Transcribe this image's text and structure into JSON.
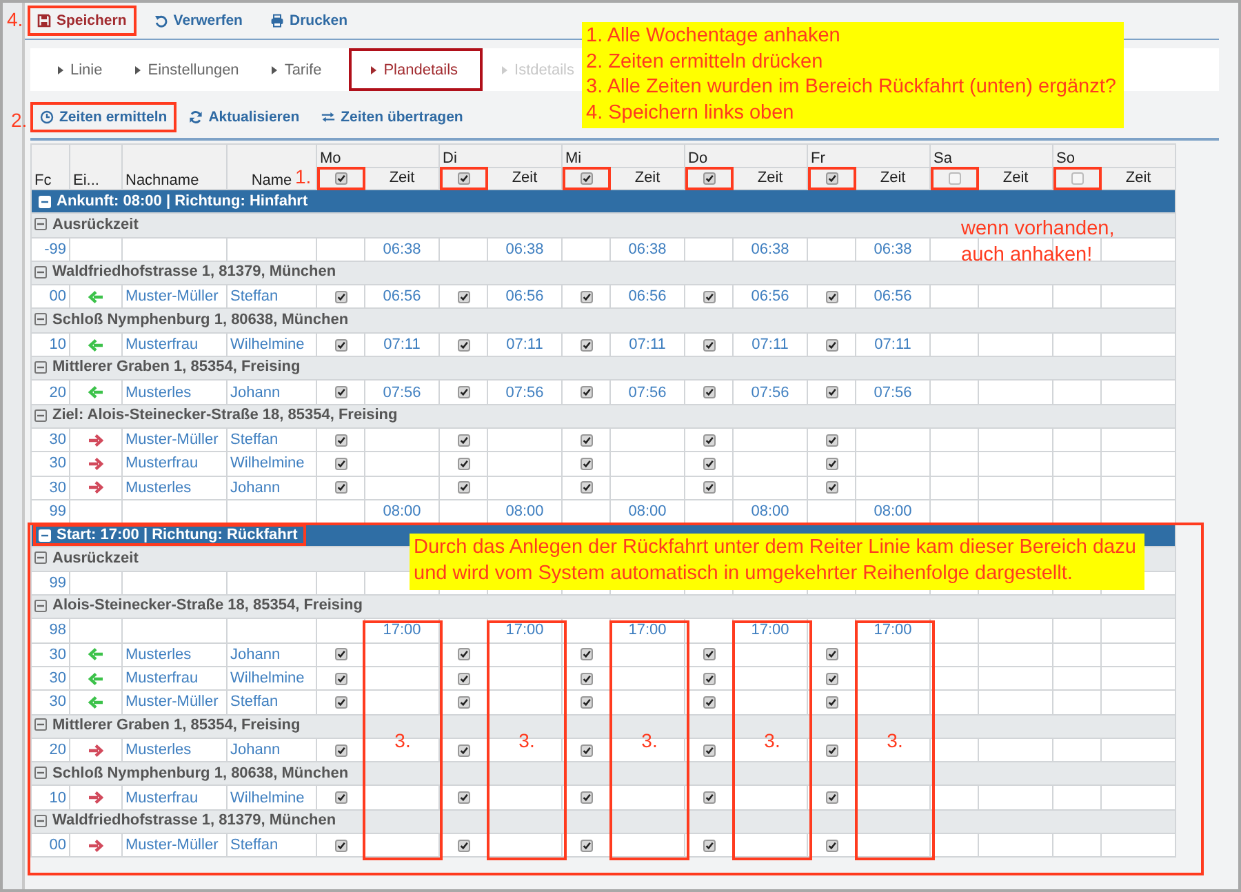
{
  "toolbar": {
    "step_label": "4.",
    "buttons": [
      {
        "label": "Speichern",
        "highlighted": true
      },
      {
        "label": "Verwerfen",
        "highlighted": false
      },
      {
        "label": "Drucken",
        "highlighted": false
      }
    ]
  },
  "tabs": [
    {
      "label": "Linie",
      "selected": false,
      "disabled": false,
      "highlighted": false
    },
    {
      "label": "Einstellungen",
      "selected": false,
      "disabled": false,
      "highlighted": false
    },
    {
      "label": "Tarife",
      "selected": false,
      "disabled": false,
      "highlighted": false
    },
    {
      "label": "Plandetails",
      "selected": true,
      "disabled": false,
      "highlighted": true
    },
    {
      "label": "Istdetails",
      "selected": false,
      "disabled": true,
      "highlighted": false
    }
  ],
  "actions": {
    "step_label": "2.",
    "buttons": [
      {
        "label": "Zeiten ermitteln",
        "highlighted": true
      },
      {
        "label": "Aktualisieren",
        "highlighted": false
      },
      {
        "label": "Zeiten übertragen",
        "highlighted": false
      }
    ]
  },
  "table": {
    "step_label": "1.",
    "columns": [
      "Fc",
      "Ei...",
      "Nachname",
      "Name"
    ],
    "days": [
      {
        "label": "Mo",
        "checked": true,
        "highlighted": true,
        "time_label": "Zeit"
      },
      {
        "label": "Di",
        "checked": true,
        "highlighted": true,
        "time_label": "Zeit"
      },
      {
        "label": "Mi",
        "checked": true,
        "highlighted": true,
        "time_label": "Zeit"
      },
      {
        "label": "Do",
        "checked": true,
        "highlighted": true,
        "time_label": "Zeit"
      },
      {
        "label": "Fr",
        "checked": true,
        "highlighted": true,
        "time_label": "Zeit"
      },
      {
        "label": "Sa",
        "checked": false,
        "highlighted": true,
        "time_label": "Zeit"
      },
      {
        "label": "So",
        "checked": false,
        "highlighted": true,
        "time_label": "Zeit"
      }
    ],
    "sections": [
      {
        "title": "Ankunft: 08:00 | Richtung: Hinfahrt",
        "expanded": true,
        "highlighted": false,
        "groups": [
          {
            "title": "Ausrückzeit",
            "expanded": true,
            "rows": [
              {
                "fc": "-99",
                "days": [
                  {
                    "checked": false,
                    "time": "06:38"
                  },
                  {
                    "checked": false,
                    "time": "06:38"
                  },
                  {
                    "checked": false,
                    "time": "06:38"
                  },
                  {
                    "checked": false,
                    "time": "06:38"
                  },
                  {
                    "checked": false,
                    "time": "06:38"
                  },
                  {
                    "checked": false
                  },
                  {
                    "checked": false
                  }
                ]
              }
            ]
          },
          {
            "title": "Waldfriedhofstrasse 1, 81379, München",
            "expanded": true,
            "rows": [
              {
                "fc": "00",
                "kind": "incoming",
                "nachname": "Muster-Müller",
                "name": "Steffan",
                "days": [
                  {
                    "checked": true,
                    "time": "06:56"
                  },
                  {
                    "checked": true,
                    "time": "06:56"
                  },
                  {
                    "checked": true,
                    "time": "06:56"
                  },
                  {
                    "checked": true,
                    "time": "06:56"
                  },
                  {
                    "checked": true,
                    "time": "06:56"
                  },
                  {
                    "checked": false
                  },
                  {
                    "checked": false
                  }
                ]
              }
            ]
          },
          {
            "title": "Schloß Nymphenburg 1, 80638, München",
            "expanded": true,
            "rows": [
              {
                "fc": "10",
                "kind": "incoming",
                "nachname": "Musterfrau",
                "name": "Wilhelmine",
                "days": [
                  {
                    "checked": true,
                    "time": "07:11"
                  },
                  {
                    "checked": true,
                    "time": "07:11"
                  },
                  {
                    "checked": true,
                    "time": "07:11"
                  },
                  {
                    "checked": true,
                    "time": "07:11"
                  },
                  {
                    "checked": true,
                    "time": "07:11"
                  },
                  {
                    "checked": false
                  },
                  {
                    "checked": false
                  }
                ]
              }
            ]
          },
          {
            "title": "Mittlerer Graben 1, 85354, Freising",
            "expanded": true,
            "rows": [
              {
                "fc": "20",
                "kind": "incoming",
                "nachname": "Musterles",
                "name": "Johann",
                "days": [
                  {
                    "checked": true,
                    "time": "07:56"
                  },
                  {
                    "checked": true,
                    "time": "07:56"
                  },
                  {
                    "checked": true,
                    "time": "07:56"
                  },
                  {
                    "checked": true,
                    "time": "07:56"
                  },
                  {
                    "checked": true,
                    "time": "07:56"
                  },
                  {
                    "checked": false
                  },
                  {
                    "checked": false
                  }
                ]
              }
            ]
          },
          {
            "title": "Ziel: Alois-Steinecker-Straße 18, 85354, Freising",
            "expanded": true,
            "rows": [
              {
                "fc": "30",
                "kind": "outgoing",
                "nachname": "Muster-Müller",
                "name": "Steffan",
                "days": [
                  {
                    "checked": true
                  },
                  {
                    "checked": true
                  },
                  {
                    "checked": true
                  },
                  {
                    "checked": true
                  },
                  {
                    "checked": true
                  },
                  {
                    "checked": false
                  },
                  {
                    "checked": false
                  }
                ]
              },
              {
                "fc": "30",
                "kind": "outgoing",
                "nachname": "Musterfrau",
                "name": "Wilhelmine",
                "days": [
                  {
                    "checked": true
                  },
                  {
                    "checked": true
                  },
                  {
                    "checked": true
                  },
                  {
                    "checked": true
                  },
                  {
                    "checked": true
                  },
                  {
                    "checked": false
                  },
                  {
                    "checked": false
                  }
                ]
              },
              {
                "fc": "30",
                "kind": "outgoing",
                "nachname": "Musterles",
                "name": "Johann",
                "days": [
                  {
                    "checked": true
                  },
                  {
                    "checked": true
                  },
                  {
                    "checked": true
                  },
                  {
                    "checked": true
                  },
                  {
                    "checked": true
                  },
                  {
                    "checked": false
                  },
                  {
                    "checked": false
                  }
                ]
              },
              {
                "fc": "99",
                "days": [
                  {
                    "checked": false,
                    "time": "08:00"
                  },
                  {
                    "checked": false,
                    "time": "08:00"
                  },
                  {
                    "checked": false,
                    "time": "08:00"
                  },
                  {
                    "checked": false,
                    "time": "08:00"
                  },
                  {
                    "checked": false,
                    "time": "08:00"
                  },
                  {
                    "checked": false
                  },
                  {
                    "checked": false
                  }
                ]
              }
            ]
          }
        ]
      },
      {
        "title": "Start: 17:00 | Richtung: Rückfahrt",
        "expanded": true,
        "highlighted": true,
        "groups": [
          {
            "title": "Ausrückzeit",
            "expanded": true,
            "rows": [
              {
                "fc": "99",
                "days": [
                  {
                    "checked": false
                  },
                  {
                    "checked": false
                  },
                  {
                    "checked": false
                  },
                  {
                    "checked": false
                  },
                  {
                    "checked": false
                  },
                  {
                    "checked": false
                  },
                  {
                    "checked": false
                  }
                ]
              }
            ]
          },
          {
            "title": "Alois-Steinecker-Straße 18, 85354, Freising",
            "expanded": true,
            "rows": [
              {
                "fc": "98",
                "days": [
                  {
                    "checked": false,
                    "time": "17:00"
                  },
                  {
                    "checked": false,
                    "time": "17:00"
                  },
                  {
                    "checked": false,
                    "time": "17:00"
                  },
                  {
                    "checked": false,
                    "time": "17:00"
                  },
                  {
                    "checked": false,
                    "time": "17:00"
                  },
                  {
                    "checked": false
                  },
                  {
                    "checked": false
                  }
                ]
              },
              {
                "fc": "30",
                "kind": "incoming",
                "nachname": "Musterles",
                "name": "Johann",
                "days": [
                  {
                    "checked": true
                  },
                  {
                    "checked": true
                  },
                  {
                    "checked": true
                  },
                  {
                    "checked": true
                  },
                  {
                    "checked": true
                  },
                  {
                    "checked": false
                  },
                  {
                    "checked": false
                  }
                ]
              },
              {
                "fc": "30",
                "kind": "incoming",
                "nachname": "Musterfrau",
                "name": "Wilhelmine",
                "days": [
                  {
                    "checked": true
                  },
                  {
                    "checked": true
                  },
                  {
                    "checked": true
                  },
                  {
                    "checked": true
                  },
                  {
                    "checked": true
                  },
                  {
                    "checked": false
                  },
                  {
                    "checked": false
                  }
                ]
              },
              {
                "fc": "30",
                "kind": "incoming",
                "nachname": "Muster-Müller",
                "name": "Steffan",
                "days": [
                  {
                    "checked": true
                  },
                  {
                    "checked": true
                  },
                  {
                    "checked": true
                  },
                  {
                    "checked": true
                  },
                  {
                    "checked": true
                  },
                  {
                    "checked": false
                  },
                  {
                    "checked": false
                  }
                ]
              }
            ]
          },
          {
            "title": "Mittlerer Graben 1, 85354, Freising",
            "expanded": true,
            "rows": [
              {
                "fc": "20",
                "kind": "outgoing",
                "nachname": "Musterles",
                "name": "Johann",
                "days": [
                  {
                    "checked": true
                  },
                  {
                    "checked": true
                  },
                  {
                    "checked": true
                  },
                  {
                    "checked": true
                  },
                  {
                    "checked": true
                  },
                  {
                    "checked": false
                  },
                  {
                    "checked": false
                  }
                ]
              }
            ]
          },
          {
            "title": "Schloß Nymphenburg 1, 80638, München",
            "expanded": true,
            "rows": [
              {
                "fc": "10",
                "kind": "outgoing",
                "nachname": "Musterfrau",
                "name": "Wilhelmine",
                "days": [
                  {
                    "checked": true
                  },
                  {
                    "checked": true
                  },
                  {
                    "checked": true
                  },
                  {
                    "checked": true
                  },
                  {
                    "checked": true
                  },
                  {
                    "checked": false
                  },
                  {
                    "checked": false
                  }
                ]
              }
            ]
          },
          {
            "title": "Waldfriedhofstrasse 1, 81379, München",
            "expanded": true,
            "rows": [
              {
                "fc": "00",
                "kind": "outgoing",
                "nachname": "Muster-Müller",
                "name": "Steffan",
                "days": [
                  {
                    "checked": true
                  },
                  {
                    "checked": true
                  },
                  {
                    "checked": true
                  },
                  {
                    "checked": true
                  },
                  {
                    "checked": true
                  },
                  {
                    "checked": false
                  },
                  {
                    "checked": false
                  }
                ]
              }
            ]
          }
        ]
      }
    ]
  },
  "annotations": {
    "instructions": [
      "1. Alle Wochentage anhaken",
      "2. Zeiten ermitteln drücken",
      "3. Alle Zeiten wurden im Bereich Rückfahrt (unten) ergänzt?",
      "4. Speichern links oben"
    ],
    "weekend_note": [
      "wenn vorhanden,",
      "auch anhaken!"
    ],
    "return_note": [
      "Durch das Anlegen der Rückfahrt unter dem Reiter Linie kam dieser Bereich dazu",
      "und wird vom System automatisch in umgekehrter Reihenfolge dargestellt."
    ],
    "time_column_marks": [
      "3.",
      "3.",
      "3.",
      "3.",
      "3."
    ]
  }
}
